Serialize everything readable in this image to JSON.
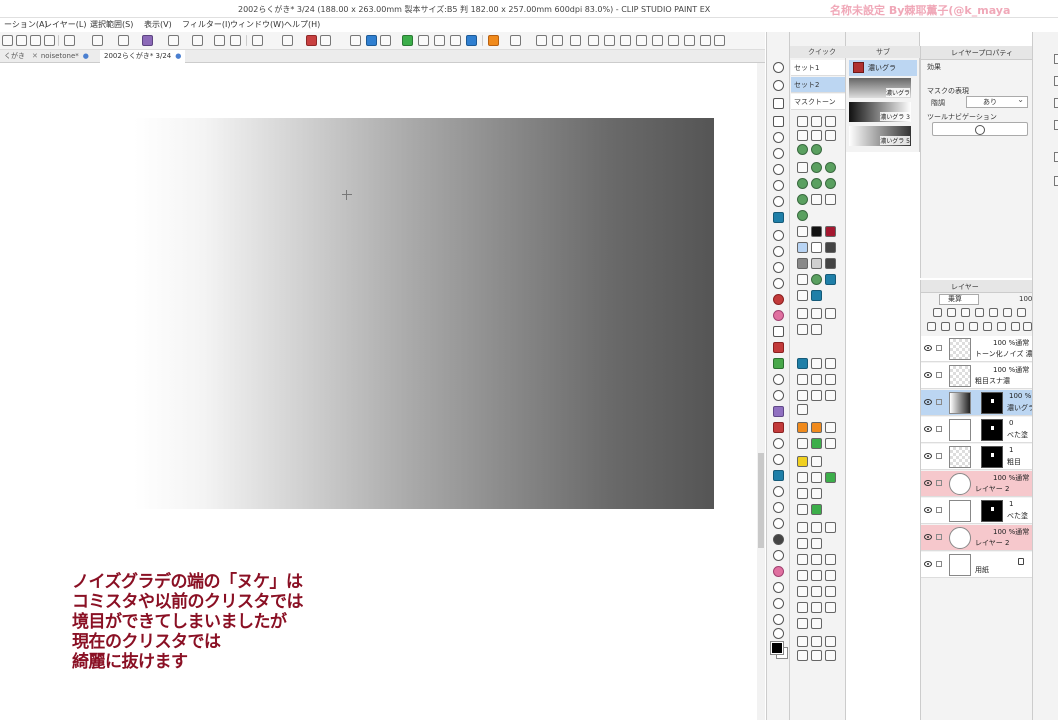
{
  "window": {
    "title": "2002らくがき* 3/24 (188.00 x 263.00mm 製本サイズ:B5 判 182.00 x 257.00mm 600dpi 83.0%) - CLIP STUDIO PAINT EX",
    "watermark": "名称未設定 By棘耶薫子(@k_maya"
  },
  "menubar": {
    "items": [
      "ーション(A)",
      "レイヤー(L)",
      "選択範囲(S)",
      "表示(V)",
      "フィルター(I)",
      "ウィンドウ(W)",
      "ヘルプ(H)"
    ]
  },
  "tabs": [
    {
      "label": "くがき",
      "active": false
    },
    {
      "label": "noisetone*",
      "active": false
    },
    {
      "label": "2002らくがき* 3/24",
      "active": true
    }
  ],
  "caption": {
    "lines": [
      "ノイズグラデの端の「ヌケ」は",
      "コミスタや以前のクリスタでは",
      "境目ができてしまいましたが",
      "現在のクリスタでは",
      "綺麗に抜けます"
    ],
    "color": "#8a1024"
  },
  "subtool_panel": {
    "tab_label": "クイック",
    "sets": [
      "セット1",
      "セット2",
      "マスクトーン"
    ],
    "selected_set": "セット2"
  },
  "brush_panel": {
    "tab_label": "サブ",
    "selected": "濃いグラ",
    "previews": [
      "濃いグラ",
      "濃いグラ 3",
      "濃いグラ 5"
    ]
  },
  "layer_property": {
    "title": "レイヤープロパティ",
    "effect_label": "効果",
    "mask_label": "マスクの表現",
    "gradation_label": "階調",
    "gradation_value": "あり",
    "tool_nav_label": "ツールナビゲーション"
  },
  "layer_panel": {
    "title": "レイヤー",
    "blend_mode": "乗算",
    "opacity": "100",
    "layers": [
      {
        "top": "100 %通常",
        "name": "トーン化ノイズ 濃度",
        "style": "normal"
      },
      {
        "top": "100 %通常",
        "name": "粗目スナ濃",
        "style": "normal"
      },
      {
        "top": "100 %",
        "name": "濃いグラ",
        "style": "selected"
      },
      {
        "top": "0",
        "name": "べた塗",
        "style": "normal"
      },
      {
        "top": "1",
        "name": "粗目",
        "style": "normal"
      },
      {
        "top": "100 %通常",
        "name": "レイヤー 2",
        "style": "pink"
      },
      {
        "top": "1",
        "name": "べた塗",
        "style": "normal"
      },
      {
        "top": "100 %通常",
        "name": "レイヤー 2",
        "style": "pink"
      },
      {
        "top": "",
        "name": "用紙",
        "style": "normal"
      }
    ]
  }
}
